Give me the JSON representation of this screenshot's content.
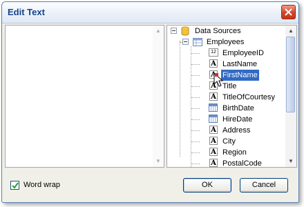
{
  "dialog": {
    "title": "Edit Text"
  },
  "tree": {
    "root": "Data Sources",
    "table": "Employees",
    "fields": [
      {
        "name": "EmployeeID",
        "type": "number-icon"
      },
      {
        "name": "LastName",
        "type": "text-icon"
      },
      {
        "name": "FirstName",
        "type": "text-icon",
        "selected": true
      },
      {
        "name": "Title",
        "type": "text-icon"
      },
      {
        "name": "TitleOfCourtesy",
        "type": "text-icon"
      },
      {
        "name": "BirthDate",
        "type": "date-icon"
      },
      {
        "name": "HireDate",
        "type": "date-icon"
      },
      {
        "name": "Address",
        "type": "text-icon"
      },
      {
        "name": "City",
        "type": "text-icon"
      },
      {
        "name": "Region",
        "type": "text-icon"
      },
      {
        "name": "PostalCode",
        "type": "text-icon"
      }
    ],
    "number_icon_text": "12",
    "text_icon_text": "A"
  },
  "footer": {
    "word_wrap_label": "Word wrap",
    "word_wrap_checked": true,
    "ok_label": "OK",
    "cancel_label": "Cancel"
  }
}
